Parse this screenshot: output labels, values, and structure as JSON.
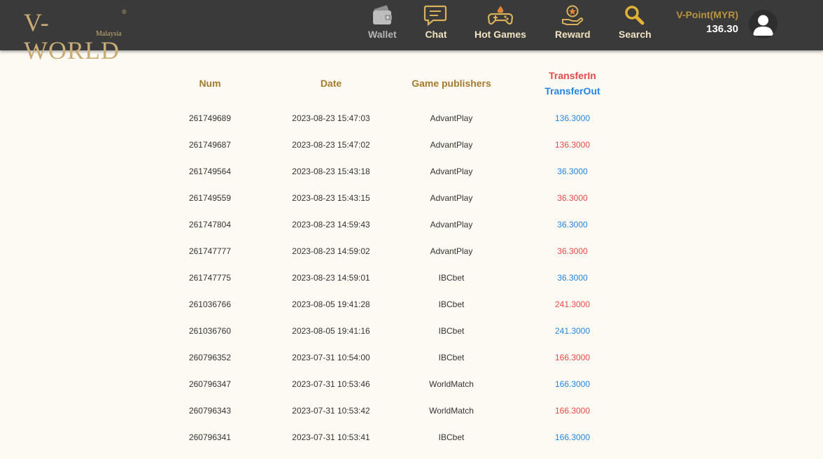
{
  "brand": {
    "logo_text": "V-WORLD",
    "logo_sub": "Malaysia",
    "logo_reg": "®"
  },
  "nav": [
    {
      "id": "wallet",
      "label": "Wallet",
      "icon": "wallet-icon",
      "disabled": true
    },
    {
      "id": "chat",
      "label": "Chat",
      "icon": "chat-icon"
    },
    {
      "id": "hot-games",
      "label": "Hot Games",
      "icon": "gamepad-flame-icon"
    },
    {
      "id": "reward",
      "label": "Reward",
      "icon": "reward-hand-icon"
    },
    {
      "id": "search",
      "label": "Search",
      "icon": "search-icon"
    }
  ],
  "wallet": {
    "currency_label": "V-Point(MYR)",
    "balance": "136.30"
  },
  "table": {
    "columns": {
      "num": "Num",
      "date": "Date",
      "publisher": "Game publishers",
      "transfer_in": "TransferIn",
      "transfer_out": "TransferOut"
    },
    "rows": [
      {
        "num": "261749689",
        "date": "2023-08-23 15:47:03",
        "publisher": "AdvantPlay",
        "amount": "136.3000",
        "direction": "out"
      },
      {
        "num": "261749687",
        "date": "2023-08-23 15:47:02",
        "publisher": "AdvantPlay",
        "amount": "136.3000",
        "direction": "in"
      },
      {
        "num": "261749564",
        "date": "2023-08-23 15:43:18",
        "publisher": "AdvantPlay",
        "amount": "36.3000",
        "direction": "out"
      },
      {
        "num": "261749559",
        "date": "2023-08-23 15:43:15",
        "publisher": "AdvantPlay",
        "amount": "36.3000",
        "direction": "in"
      },
      {
        "num": "261747804",
        "date": "2023-08-23 14:59:43",
        "publisher": "AdvantPlay",
        "amount": "36.3000",
        "direction": "out"
      },
      {
        "num": "261747777",
        "date": "2023-08-23 14:59:02",
        "publisher": "AdvantPlay",
        "amount": "36.3000",
        "direction": "in"
      },
      {
        "num": "261747775",
        "date": "2023-08-23 14:59:01",
        "publisher": "IBCbet",
        "amount": "36.3000",
        "direction": "out"
      },
      {
        "num": "261036766",
        "date": "2023-08-05 19:41:28",
        "publisher": "IBCbet",
        "amount": "241.3000",
        "direction": "in"
      },
      {
        "num": "261036760",
        "date": "2023-08-05 19:41:16",
        "publisher": "IBCbet",
        "amount": "241.3000",
        "direction": "out"
      },
      {
        "num": "260796352",
        "date": "2023-07-31 10:54:00",
        "publisher": "IBCbet",
        "amount": "166.3000",
        "direction": "in"
      },
      {
        "num": "260796347",
        "date": "2023-07-31 10:53:46",
        "publisher": "WorldMatch",
        "amount": "166.3000",
        "direction": "out"
      },
      {
        "num": "260796343",
        "date": "2023-07-31 10:53:42",
        "publisher": "WorldMatch",
        "amount": "166.3000",
        "direction": "in"
      },
      {
        "num": "260796341",
        "date": "2023-07-31 10:53:41",
        "publisher": "IBCbet",
        "amount": "166.3000",
        "direction": "out"
      }
    ]
  },
  "colors": {
    "header_bg": "#3a3a3a",
    "page_bg": "#fdfaf3",
    "gold": "#a47a2c",
    "transfer_in": "#e84949",
    "transfer_out": "#2186e4"
  }
}
